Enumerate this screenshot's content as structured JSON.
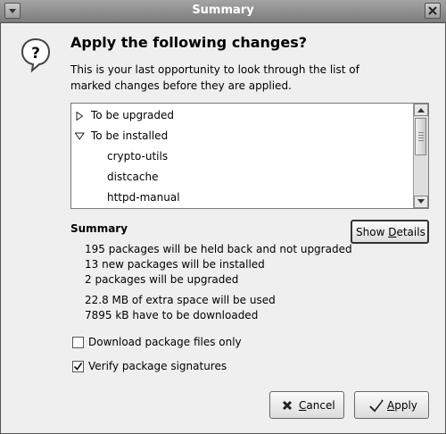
{
  "window": {
    "title": "Summary"
  },
  "dialog": {
    "heading": "Apply the following changes?",
    "description": "This is your last opportunity to look through the list of marked changes before they are applied.",
    "tree": [
      {
        "label": "To be upgraded",
        "expanded": false,
        "level": 0
      },
      {
        "label": "To be installed",
        "expanded": true,
        "level": 0
      },
      {
        "label": "crypto-utils",
        "level": 1
      },
      {
        "label": "distcache",
        "level": 1
      },
      {
        "label": "httpd-manual",
        "level": 1
      }
    ],
    "summary": {
      "title": "Summary",
      "lines": [
        "195 packages will be held back and not upgraded",
        "13 new packages will be installed",
        "2 packages will be upgraded",
        "22.8 MB of extra space will be used",
        "7895 kB have to be downloaded"
      ]
    },
    "show_details_label": "Show Details",
    "options": {
      "download_only": {
        "label": "Download package files only",
        "checked": false
      },
      "verify_signatures": {
        "label": "Verify package signatures",
        "checked": true
      }
    },
    "cancel_label": "Cancel",
    "apply_label": "Apply"
  }
}
